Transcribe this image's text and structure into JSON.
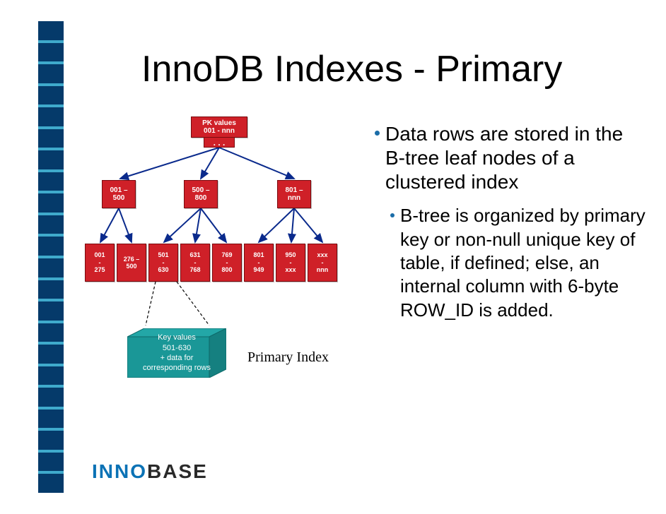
{
  "title": "InnoDB Indexes - Primary",
  "tree": {
    "root": {
      "line1": "PK values",
      "line2": "001 - nnn"
    },
    "dots": ". . .",
    "level1": [
      {
        "line1": "001 –",
        "line2": "500"
      },
      {
        "line1": "500 –",
        "line2": "800"
      },
      {
        "line1": "801 –",
        "line2": "nnn"
      }
    ],
    "leaves": [
      {
        "line1": "001",
        "line2": "-",
        "line3": "275"
      },
      {
        "line1": "276 –",
        "line2": "500",
        "line3": ""
      },
      {
        "line1": "501",
        "line2": "-",
        "line3": "630"
      },
      {
        "line1": "631",
        "line2": "-",
        "line3": "768"
      },
      {
        "line1": "769",
        "line2": "-",
        "line3": "800"
      },
      {
        "line1": "801",
        "line2": "-",
        "line3": "949"
      },
      {
        "line1": "950",
        "line2": "-",
        "line3": "xxx"
      },
      {
        "line1": "xxx",
        "line2": "-",
        "line3": "nnn"
      }
    ],
    "data_block": "Key values\n501-630\n+ data for\ncorresponding rows",
    "colors": {
      "node_fill": "#cf2028",
      "node_border": "#7a0a0e",
      "data_fill": "#1a9797",
      "data_edge": "#0e6a6a"
    }
  },
  "labels": {
    "primary_index": "Primary Index"
  },
  "bullets": {
    "b1": "Data rows are stored in the B-tree leaf nodes of a clustered index",
    "b2": "B-tree is organized by primary key or non-null unique key of table, if defined; else, an internal column with 6-byte ROW_ID is added."
  },
  "logo": {
    "part1": "INNO",
    "part2": "BASE"
  },
  "decorations": {
    "side_strip_segments": 22
  }
}
